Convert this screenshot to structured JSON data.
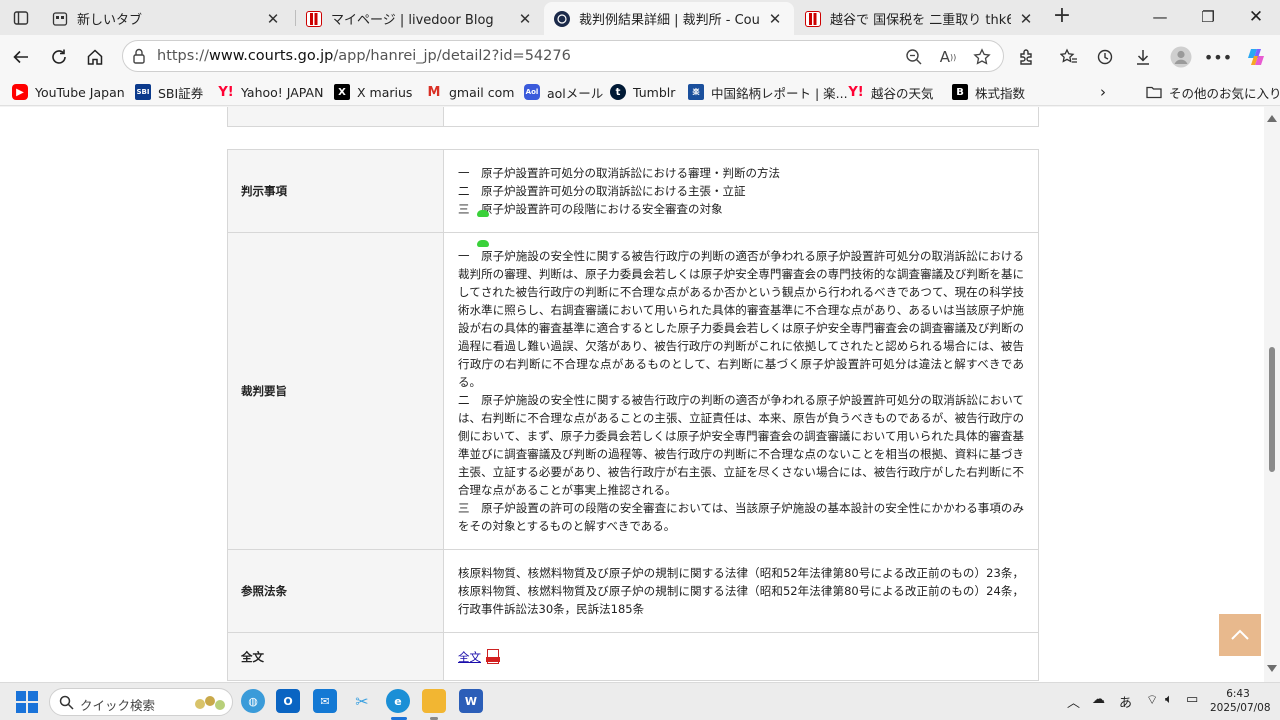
{
  "tabs": [
    {
      "title": "新しいタブ",
      "favicon": "newtab-icon"
    },
    {
      "title": "マイページ | livedoor Blog",
      "favicon": "livedoor-icon"
    },
    {
      "title": "裁判例結果詳細 | 裁判所 - Courts",
      "favicon": "courts-icon",
      "active": true
    },
    {
      "title": "越谷で 国保税を 二重取り thk6",
      "favicon": "livedoor-icon"
    }
  ],
  "address": {
    "url_prefix": "https://",
    "url_host": "www.courts.go.jp",
    "url_path": "/app/hanrei_jp/detail2?id=54276"
  },
  "bookmarks": [
    {
      "label": "YouTube Japan",
      "icon": "youtube-icon",
      "color": "#ff0000"
    },
    {
      "label": "SBI証券",
      "icon": "sbi-icon",
      "color": "#0b3a8c"
    },
    {
      "label": "Yahoo! JAPAN",
      "icon": "yahoo-icon",
      "color": "#ff0033"
    },
    {
      "label": "X marius",
      "icon": "x-icon",
      "color": "#000000"
    },
    {
      "label": "gmail com",
      "icon": "gmail-icon",
      "color": "#d93025"
    },
    {
      "label": "aolメール",
      "icon": "aol-icon",
      "color": "#3b5bdb"
    },
    {
      "label": "Tumblr",
      "icon": "tumblr-icon",
      "color": "#001935"
    },
    {
      "label": "中国銘柄レポート | 楽...",
      "icon": "rakuten-icon",
      "color": "#1a4f9c"
    },
    {
      "label": "越谷の天気",
      "icon": "yahoo-icon",
      "color": "#ff0033"
    },
    {
      "label": "株式指数",
      "icon": "b-icon",
      "color": "#000000"
    }
  ],
  "bookmarks_other": "その他のお気に入り",
  "rows": {
    "hanji_label": "判示事項",
    "hanji": [
      "一　原子炉設置許可処分の取消訴訟における審理・判断の方法",
      "二　原子炉設置許可処分の取消訴訟における主張・立証",
      "三　原子炉設置許可の段階における安全審査の対象"
    ],
    "yoshi_label": "裁判要旨",
    "yoshi": [
      "一　原子炉施設の安全性に関する被告行政庁の判断の適否が争われる原子炉設置許可処分の取消訴訟における裁判所の審理、判断は、原子力委員会若しくは原子炉安全専門審査会の専門技術的な調査審議及び判断を基にしてされた被告行政庁の判断に不合理な点があるか否かという観点から行われるべきであつて、現在の科学技術水準に照らし、右調査審議において用いられた具体的審査基準に不合理な点があり、あるいは当該原子炉施設が右の具体的審査基準に適合するとした原子力委員会若しくは原子炉安全専門審査会の調査審議及び判断の過程に看過し難い過誤、欠落があり、被告行政庁の判断がこれに依拠してされたと認められる場合には、被告行政庁の右判断に不合理な点があるものとして、右判断に基づく原子炉設置許可処分は違法と解すべきである。",
      "二　原子炉施設の安全性に関する被告行政庁の判断の適否が争われる原子炉設置許可処分の取消訴訟においては、右判断に不合理な点があることの主張、立証責任は、本来、原告が負うべきものであるが、被告行政庁の側において、まず、原子力委員会若しくは原子炉安全専門審査会の調査審議において用いられた具体的審査基準並びに調査審議及び判断の過程等、被告行政庁の判断に不合理な点のないことを相当の根拠、資料に基づき主張、立証する必要があり、被告行政庁が右主張、立証を尽くさない場合には、被告行政庁がした右判断に不合理な点があることが事実上推認される。",
      "三　原子炉設置の許可の段階の安全審査においては、当該原子炉施設の基本設計の安全性にかかわる事項のみをその対象とするものと解すべきである。"
    ],
    "hourei_label": "参照法条",
    "hourei": "核原料物質、核燃料物質及び原子炉の規制に関する法律（昭和52年法律第80号による改正前のもの）23条，核原料物質、核燃料物質及び原子炉の規制に関する法律（昭和52年法律第80号による改正前のもの）24条，行政事件訴訟法30条，民訴法185条",
    "zenbun_label": "全文",
    "zenbun_link": "全文"
  },
  "taskbar": {
    "search_placeholder": "クイック検索",
    "ime": "あ",
    "time": "6:43",
    "date": "2025/07/08"
  }
}
